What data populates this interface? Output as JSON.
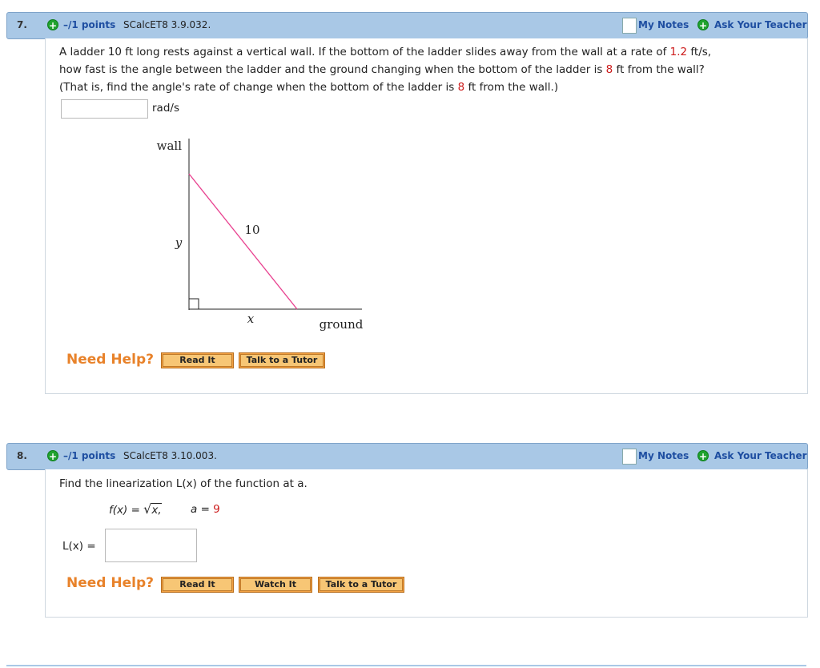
{
  "q7": {
    "number": "7.",
    "points": "–/1 points",
    "ref": "SCalcET8 3.9.032.",
    "my_notes": "My Notes",
    "ask_teacher": "Ask Your Teacher",
    "line1_a": "A ladder 10 ft long rests against a vertical wall. If the bottom of the ladder slides away from the wall at a rate of ",
    "line1_rate": "1.2",
    "line1_b": " ft/s,",
    "line2_a": "how fast is the angle between the ladder and the ground changing when the bottom of the ladder is ",
    "line2_val": "8",
    "line2_b": " ft from the wall?",
    "line3_a": "(That is, find the angle's rate of change when the bottom of the ladder is ",
    "line3_val": "8",
    "line3_b": " ft from the wall.)",
    "answer_value": "",
    "unit": "rad/s",
    "diagram": {
      "wall_label": "wall",
      "y_label": "y",
      "ladder_label": "10",
      "x_label": "x",
      "ground_label": "ground",
      "ladder_color": "#e8408f"
    },
    "need_help": "Need Help?",
    "buttons": [
      "Read It",
      "Talk to a Tutor"
    ]
  },
  "q8": {
    "number": "8.",
    "points": "–/1 points",
    "ref": "SCalcET8 3.10.003.",
    "my_notes": "My Notes",
    "ask_teacher": "Ask Your Teacher",
    "prompt": "Find the linearization L(x) of the function at a.",
    "function_lhs": "f(x) = ",
    "function_arg": "x,",
    "a_label": "a = ",
    "a_value": "9",
    "answer_label": "L(x) =",
    "answer_value": "",
    "need_help": "Need Help?",
    "buttons": [
      "Read It",
      "Watch It",
      "Talk to a Tutor"
    ]
  },
  "colors": {
    "header_bg": "#a9c8e6",
    "link_blue": "#1e4ea1",
    "accent_orange": "#e8822a",
    "red_values": "#cc1a1a"
  }
}
